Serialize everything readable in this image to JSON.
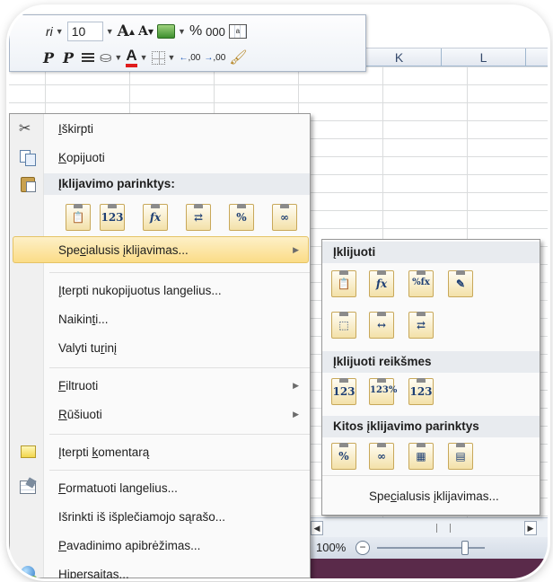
{
  "toolbar": {
    "font_name_partial": "ri",
    "font_size": "10",
    "grow_font": "A",
    "shrink_font": "A",
    "percent": "%",
    "thousands": "000",
    "bold_partial": "P",
    "italic": "P",
    "font_color_letter": "A",
    "decrease_decimal": ",00",
    "increase_decimal": ",00"
  },
  "sheet": {
    "columns": [
      "K",
      "L"
    ]
  },
  "context_menu": {
    "items": [
      {
        "pre": "",
        "u": "I",
        "post": "škirpti"
      },
      {
        "pre": "",
        "u": "K",
        "post": "opijuoti"
      },
      {
        "pre": "",
        "u": "Į",
        "post": "klijavimo parinktys:"
      },
      {
        "pre": "Spe",
        "u": "c",
        "post": "ialusis įklijavimas..."
      },
      {
        "pre": "",
        "u": "Į",
        "post": "terpti nukopijuotus langelius..."
      },
      {
        "pre": "Naikin",
        "u": "t",
        "post": "i..."
      },
      {
        "pre": "Valyti tu",
        "u": "r",
        "post": "inį"
      },
      {
        "pre": "",
        "u": "F",
        "post": "iltruoti"
      },
      {
        "pre": "",
        "u": "R",
        "post": "ūšiuoti"
      },
      {
        "pre": "Įterpti ",
        "u": "k",
        "post": "omentarą"
      },
      {
        "pre": "",
        "u": "F",
        "post": "ormatuoti langelius..."
      },
      {
        "pre": "Išrinkti iš išplečiamojo sąrašo...",
        "u": "",
        "post": ""
      },
      {
        "pre": "",
        "u": "P",
        "post": "avadinimo apibrėžimas..."
      },
      {
        "pre": "",
        "u": "H",
        "post": "ipersaitas..."
      }
    ],
    "paste_tiles": [
      "📋",
      "123",
      "fx",
      "⇄",
      "%",
      "∞"
    ]
  },
  "submenu": {
    "header_paste": "Įklijuoti",
    "header_values": "Įklijuoti reikšmes",
    "header_other": "Kitos įklijavimo parinktys",
    "paste_row1": [
      "📋",
      "fx",
      "%fx",
      "✎"
    ],
    "paste_row2": [
      "⬚",
      "↔",
      "⇄"
    ],
    "values_row": [
      "123",
      "123%",
      "123"
    ],
    "other_row": [
      "%",
      "∞",
      "▦",
      "▤"
    ],
    "bottom": {
      "pre": "Spe",
      "u": "c",
      "post": "ialusis įklijavimas..."
    }
  },
  "status": {
    "zoom": "100%",
    "zoom_minus": "−"
  }
}
